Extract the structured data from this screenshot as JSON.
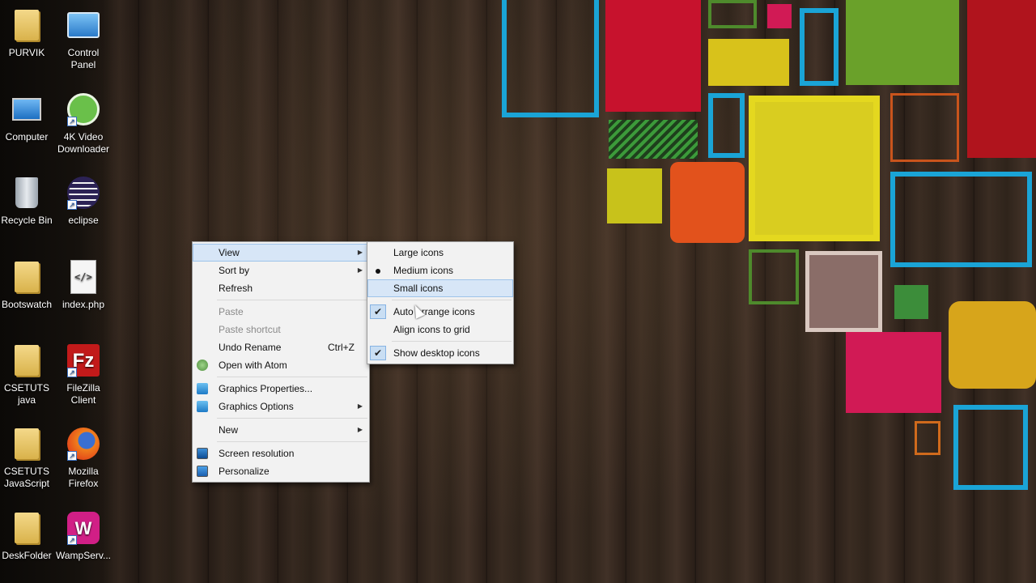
{
  "desktop": {
    "icons": [
      {
        "label": "PURVIK",
        "icon": "user-folder-icon"
      },
      {
        "label": "Control Panel",
        "icon": "control-panel-icon"
      },
      {
        "label": "Computer",
        "icon": "computer-icon"
      },
      {
        "label": "4K Video Downloader",
        "icon": "video-downloader-icon"
      },
      {
        "label": "Recycle Bin",
        "icon": "recycle-bin-icon"
      },
      {
        "label": "eclipse",
        "icon": "eclipse-icon"
      },
      {
        "label": "Bootswatch",
        "icon": "folder-icon"
      },
      {
        "label": "index.php",
        "icon": "php-file-icon"
      },
      {
        "label": "CSETUTS java",
        "icon": "folder-icon"
      },
      {
        "label": "FileZilla Client",
        "icon": "filezilla-icon"
      },
      {
        "label": "CSETUTS JavaScript",
        "icon": "folder-icon"
      },
      {
        "label": "Mozilla Firefox",
        "icon": "firefox-icon"
      },
      {
        "label": "DeskFolder",
        "icon": "folder-icon"
      },
      {
        "label": "WampServ...",
        "icon": "wampserver-icon"
      }
    ]
  },
  "context_menu": {
    "items": {
      "view": "View",
      "sort_by": "Sort by",
      "refresh": "Refresh",
      "paste": "Paste",
      "paste_shortcut": "Paste shortcut",
      "undo_rename": "Undo Rename",
      "undo_rename_key": "Ctrl+Z",
      "open_with_atom": "Open with Atom",
      "graphics_properties": "Graphics Properties...",
      "graphics_options": "Graphics Options",
      "new": "New",
      "screen_resolution": "Screen resolution",
      "personalize": "Personalize"
    }
  },
  "view_submenu": {
    "items": {
      "large_icons": "Large icons",
      "medium_icons": "Medium icons",
      "small_icons": "Small icons",
      "auto_arrange": "Auto arrange icons",
      "align_to_grid": "Align icons to grid",
      "show_desktop_icons": "Show desktop icons"
    },
    "selected_size": "Medium icons",
    "checked": [
      "Auto arrange icons",
      "Show desktop icons"
    ]
  },
  "colors": {
    "menu_bg": "#f2f2f2",
    "highlight": "#d7e6f7",
    "check_bg": "#c9def3"
  }
}
